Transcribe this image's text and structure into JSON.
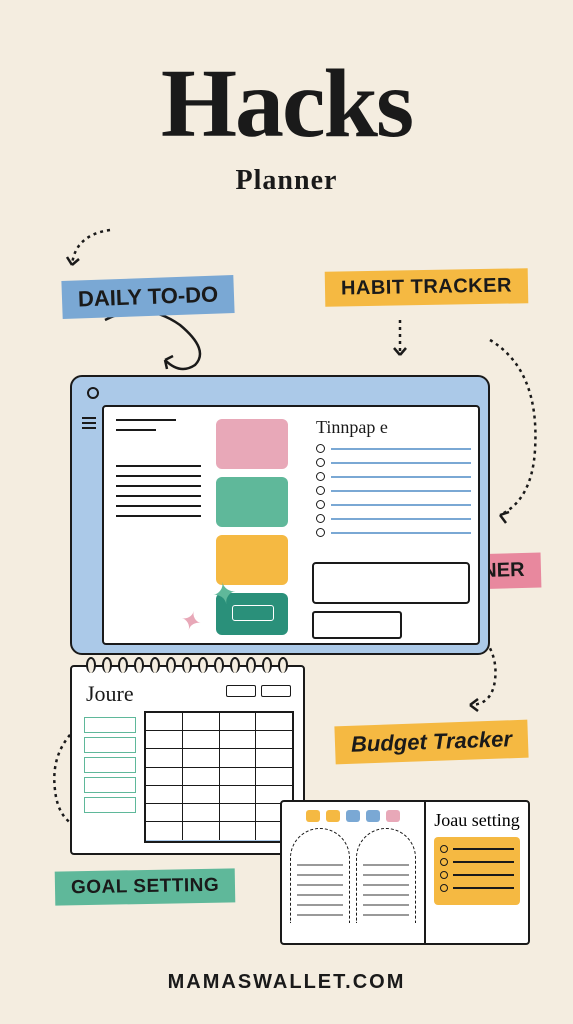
{
  "title": "Hacks",
  "subtitle": "Planner",
  "labels": {
    "daily": "DAILY TO-DO",
    "habit": "HABIT TRACKER",
    "meal": "MEAL PLANNER",
    "budget": "Budget Tracker",
    "goal": "GOAL SETTING"
  },
  "planner": {
    "right_heading": "Tinnpap e"
  },
  "notebook": {
    "title": "Joure"
  },
  "booklet": {
    "title": "Joau setting"
  },
  "footer": "MAMASWALLET.COM",
  "colors": {
    "bg": "#f4ede0",
    "blue": "#7aa8d4",
    "orange": "#f5b942",
    "pink": "#e8889e",
    "green": "#5fb89a",
    "teal": "#2a907a",
    "ink": "#1a1a1a"
  }
}
